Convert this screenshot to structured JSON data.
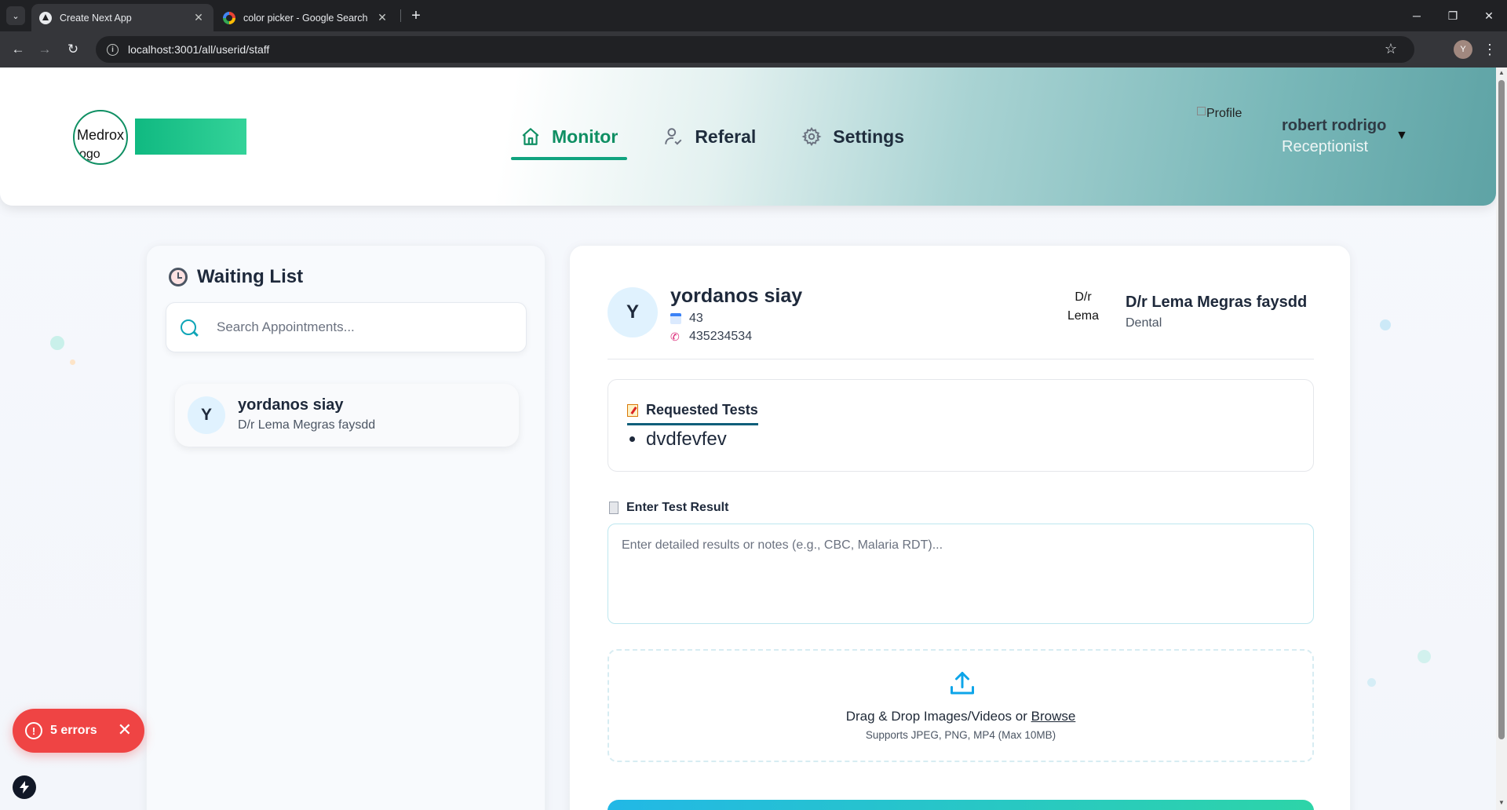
{
  "browser": {
    "tabs": [
      {
        "title": "Create Next App",
        "close": "✕"
      },
      {
        "title": "color picker - Google Search",
        "close": "✕"
      }
    ],
    "new_tab": "+",
    "url": "localhost:3001/all/userid/staff",
    "profile_initial": "Y",
    "window_controls": {
      "minimize": "─",
      "restore": "❐",
      "close": "✕"
    }
  },
  "header": {
    "logo_text": "Medrox",
    "logo_text_overflow": "ogo",
    "nav": [
      {
        "label": "Monitor",
        "icon": "home-icon",
        "active": true
      },
      {
        "label": "Referal",
        "icon": "user-check-icon",
        "active": false
      },
      {
        "label": "Settings",
        "icon": "gear-icon",
        "active": false
      }
    ],
    "profile": {
      "image_alt": "Profile",
      "name": "robert rodrigo",
      "role": "Receptionist",
      "caret": "▼"
    }
  },
  "waiting_list": {
    "title": "Waiting List",
    "search_placeholder": "Search Appointments...",
    "appointments": [
      {
        "initial": "Y",
        "name": "yordanos siay",
        "doctor": "D/r Lema Megras faysdd"
      }
    ]
  },
  "patient": {
    "initial": "Y",
    "name": "yordanos siay",
    "age": "43",
    "phone": "435234534",
    "doctor_image_alt": "D/r Lema Megra",
    "doctor_name": "D/r Lema Megras faysdd",
    "department": "Dental"
  },
  "requested_tests": {
    "title": "Requested Tests",
    "items": [
      "dvdfevfev"
    ]
  },
  "test_result": {
    "label": "Enter Test Result",
    "placeholder": "Enter detailed results or notes (e.g., CBC, Malaria RDT)..."
  },
  "upload": {
    "text": "Drag & Drop Images/Videos or ",
    "browse": "Browse",
    "supports": "Supports JPEG, PNG, MP4 (Max 10MB)"
  },
  "dev_overlay": {
    "errors_label": "5 errors",
    "close": "✕"
  },
  "colors": {
    "accent": "#0f8f63",
    "header_teal": "#5ea3a5",
    "error": "#ef4444"
  }
}
